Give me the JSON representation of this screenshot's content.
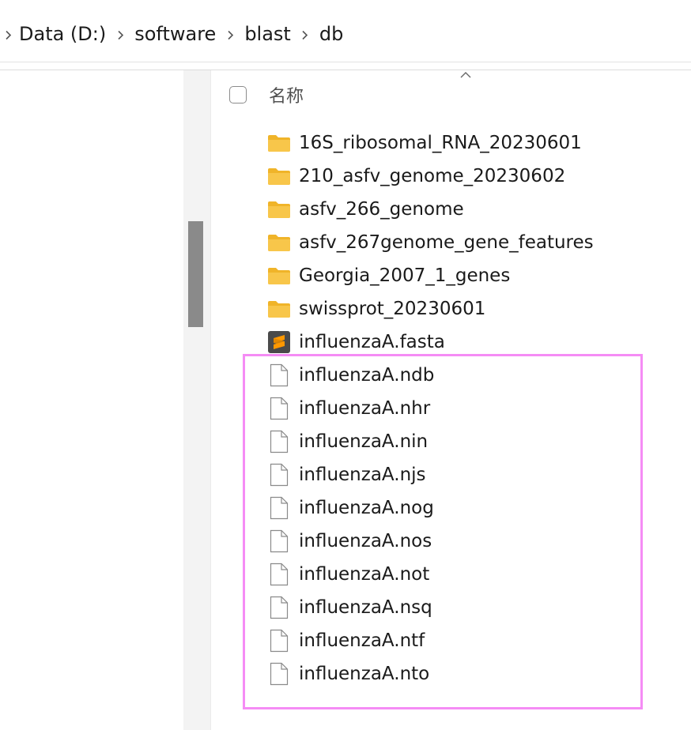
{
  "breadcrumb": [
    "Data (D:)",
    "software",
    "blast",
    "db"
  ],
  "list_header": {
    "name_label": "名称"
  },
  "files": [
    {
      "name": "16S_ribosomal_RNA_20230601",
      "icon": "folder-icon"
    },
    {
      "name": "210_asfv_genome_20230602",
      "icon": "folder-icon"
    },
    {
      "name": "asfv_266_genome",
      "icon": "folder-icon"
    },
    {
      "name": "asfv_267genome_gene_features",
      "icon": "folder-icon"
    },
    {
      "name": "Georgia_2007_1_genes",
      "icon": "folder-icon"
    },
    {
      "name": "swissprot_20230601",
      "icon": "folder-icon"
    },
    {
      "name": "influenzaA.fasta",
      "icon": "sublime-file-icon"
    },
    {
      "name": "influenzaA.ndb",
      "icon": "file-icon"
    },
    {
      "name": "influenzaA.nhr",
      "icon": "file-icon"
    },
    {
      "name": "influenzaA.nin",
      "icon": "file-icon"
    },
    {
      "name": "influenzaA.njs",
      "icon": "file-icon"
    },
    {
      "name": "influenzaA.nog",
      "icon": "file-icon"
    },
    {
      "name": "influenzaA.nos",
      "icon": "file-icon"
    },
    {
      "name": "influenzaA.not",
      "icon": "file-icon"
    },
    {
      "name": "influenzaA.nsq",
      "icon": "file-icon"
    },
    {
      "name": "influenzaA.ntf",
      "icon": "file-icon"
    },
    {
      "name": "influenzaA.nto",
      "icon": "file-icon"
    }
  ],
  "colors": {
    "highlight": "#f58cf5",
    "folder": "#f8c64a",
    "sublime": "#ff9800"
  }
}
